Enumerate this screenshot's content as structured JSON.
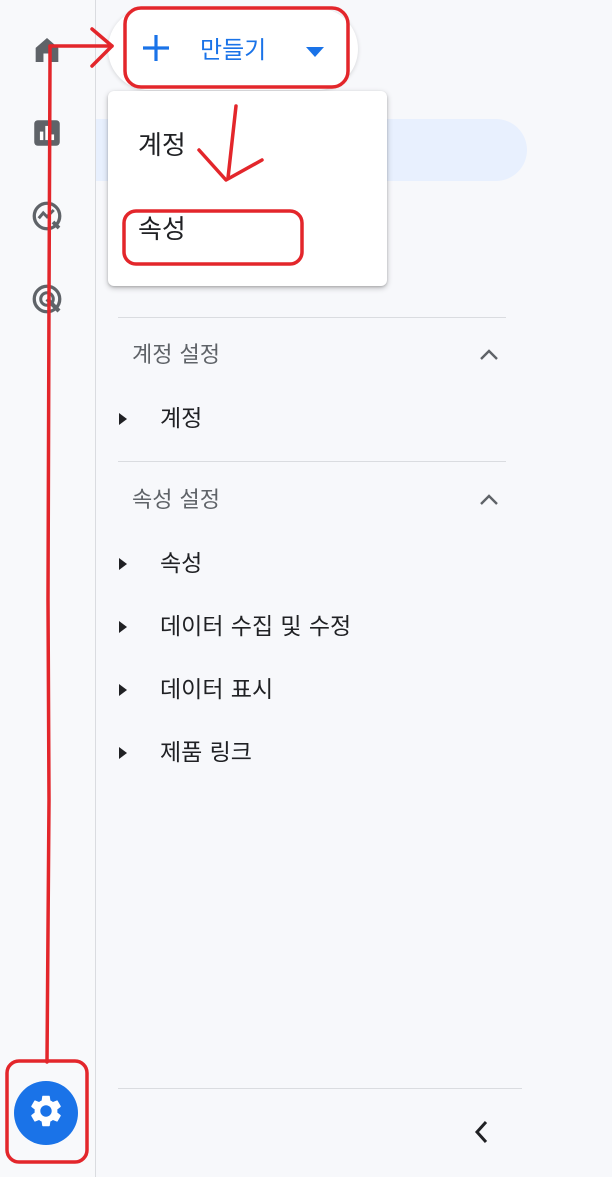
{
  "rail": {
    "icons": [
      "home-icon",
      "reports-icon",
      "explore-icon",
      "advertising-icon"
    ],
    "settings_icon": "gear-icon"
  },
  "create_button": {
    "label": "만들기",
    "icon": "plus-icon",
    "dropdown_icon": "caret-down-icon",
    "color": "#1a73e8"
  },
  "create_menu": {
    "items": [
      "계정",
      "속성"
    ]
  },
  "sections": [
    {
      "title": "계정 설정",
      "items": [
        "계정"
      ]
    },
    {
      "title": "속성 설정",
      "items": [
        "속성",
        "데이터 수집 및 수정",
        "데이터 표시",
        "제품 링크"
      ]
    }
  ],
  "collapse_icon": "chevron-left-icon",
  "annotation_color": "#e3262b"
}
